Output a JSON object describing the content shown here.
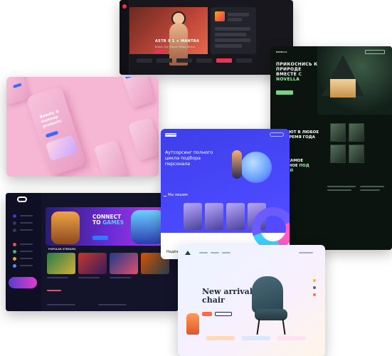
{
  "music": {
    "title": "ASTR 0 1 + MANTRA",
    "subtitle": "Broke Out Shape Mega Writer"
  },
  "novella": {
    "logo": "NOVELLA",
    "headline_main": "ПРИКОСНИСЬ К ПРИРОДЕ ВМЕСТЕ",
    "headline_accent": "С NOVELLA",
    "section_two": "УЮТ В ЛЮБОЕ ВРЕМЯ ГОДА",
    "section_three_main": "ВСЁ САМОЕ НУЖНОЕ",
    "section_three_accent": "ПОД РУКОЙ"
  },
  "pink": {
    "phone_text": "Beauty & makeup products"
  },
  "gaming": {
    "banner_line1": "CONNECT",
    "banner_line2": "TO",
    "banner_accent": "GAMES",
    "section_title": "POPULAR STREAMS"
  },
  "outsourcing": {
    "logo": "АУТСОРС",
    "title": "Аутсорсинг полного цикла подбора персонала",
    "section": "Мы пишем",
    "bottom_text": "Надёжный партнёр"
  },
  "chair": {
    "title": "New arrivals chair"
  },
  "colors": {
    "music_accent": "#e8364f",
    "novella_accent": "#a8f0b0",
    "pink_bg": "#f5b7d3",
    "gaming_accent": "#5ac8ff",
    "outsourcing_bg": "#4b49ff",
    "chair_accent": "#ff6b4a"
  }
}
